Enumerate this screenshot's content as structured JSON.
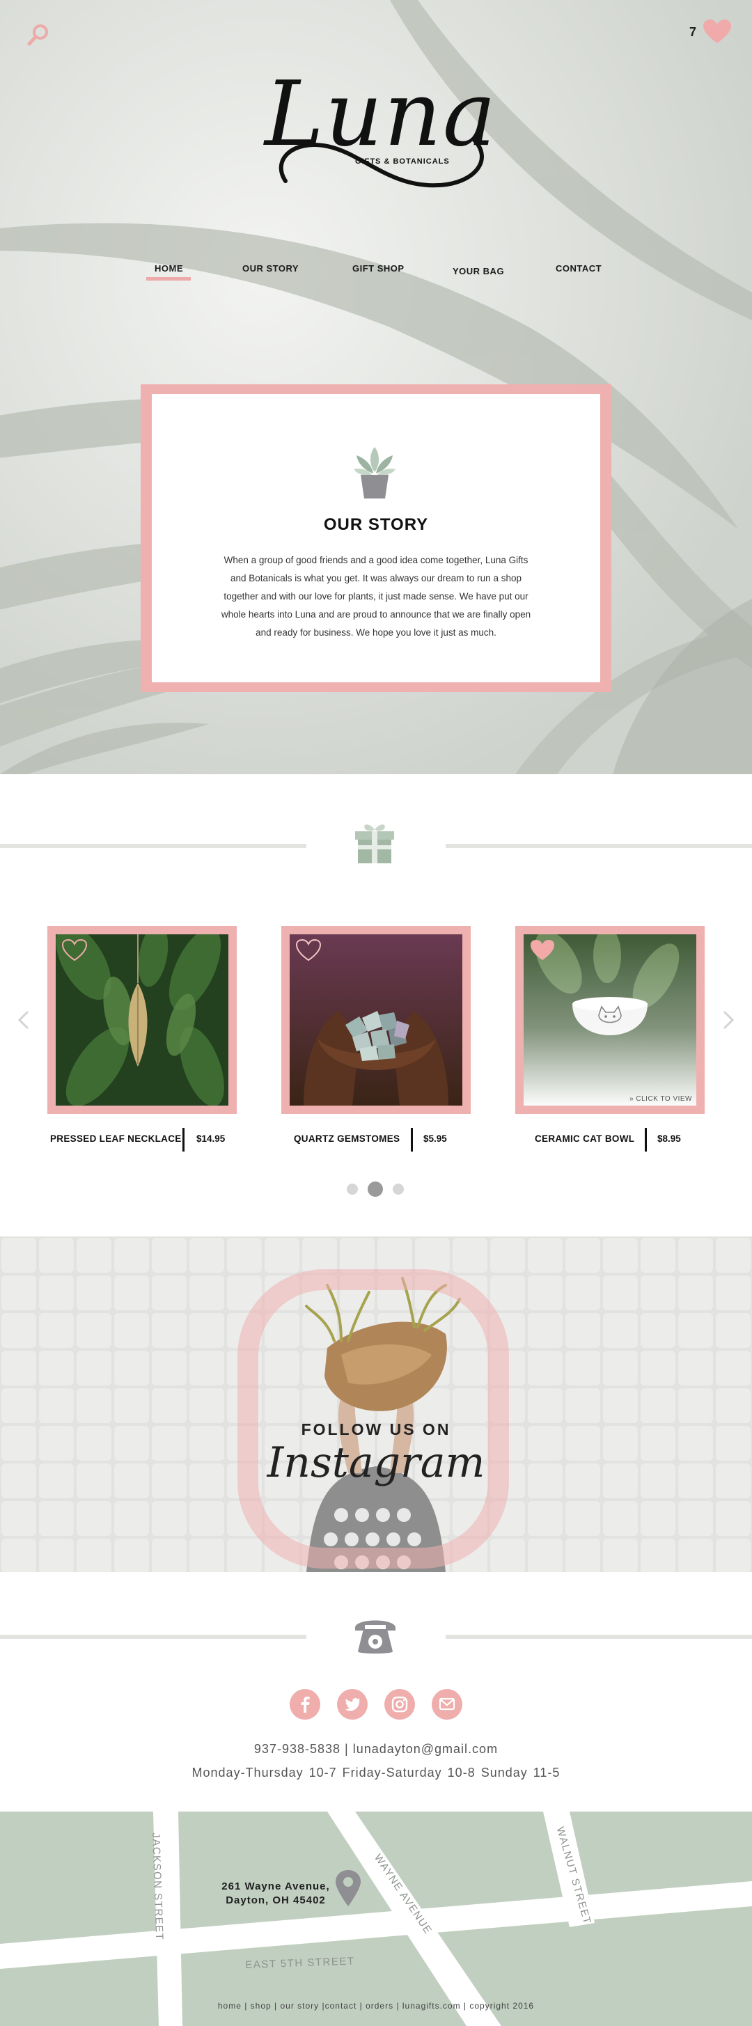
{
  "header": {
    "bag_count": "7",
    "logo_word": "Luna",
    "logo_tagline": "GIFTS & BOTANICALS"
  },
  "nav": {
    "items": [
      "HOME",
      "OUR STORY",
      "GIFT SHOP",
      "YOUR BAG",
      "CONTACT"
    ],
    "active": "HOME"
  },
  "story": {
    "title": "OUR STORY",
    "body": "When a group of good friends and a good idea come together, Luna Gifts and Botanicals is what you get. It was always our dream to run a shop together and with our love for plants, it just made sense. We have put our whole hearts into Luna and are proud to announce that we are finally open and ready for business. We hope you love it just as much."
  },
  "shop": {
    "products": [
      {
        "name": "PRESSED LEAF NECKLACE",
        "price": "$14.95",
        "favorited": false
      },
      {
        "name": "QUARTZ GEMSTOMES",
        "price": "$5.95",
        "favorited": false
      },
      {
        "name": "CERAMIC CAT BOWL",
        "price": "$8.95",
        "favorited": true,
        "hover_label": "» CLICK TO VIEW"
      }
    ],
    "pagination": {
      "count": 3,
      "active": 2
    }
  },
  "instagram": {
    "follow": "FOLLOW US ON",
    "word": "Instagram"
  },
  "contact": {
    "socials": [
      "facebook",
      "twitter",
      "instagram",
      "email"
    ],
    "line1": "937-938-5838 | lunadayton@gmail.com",
    "line2": "Monday-Thursday 10-7  Friday-Saturday 10-8  Sunday 11-5"
  },
  "map": {
    "address_line1": "261 Wayne Avenue,",
    "address_line2": "Dayton, OH 45402",
    "streets": [
      "JACKSON STREET",
      "WAYNE AVENUE",
      "WALNUT STREET",
      "EAST 5TH STREET"
    ]
  },
  "footer": {
    "links": "home | shop | our story |contact | orders | lunagifts.com | copyright 2016"
  },
  "colors": {
    "accent_pink": "#efb1b0",
    "map_green": "#c1cfc0",
    "icon_gray": "#8e8e93"
  }
}
